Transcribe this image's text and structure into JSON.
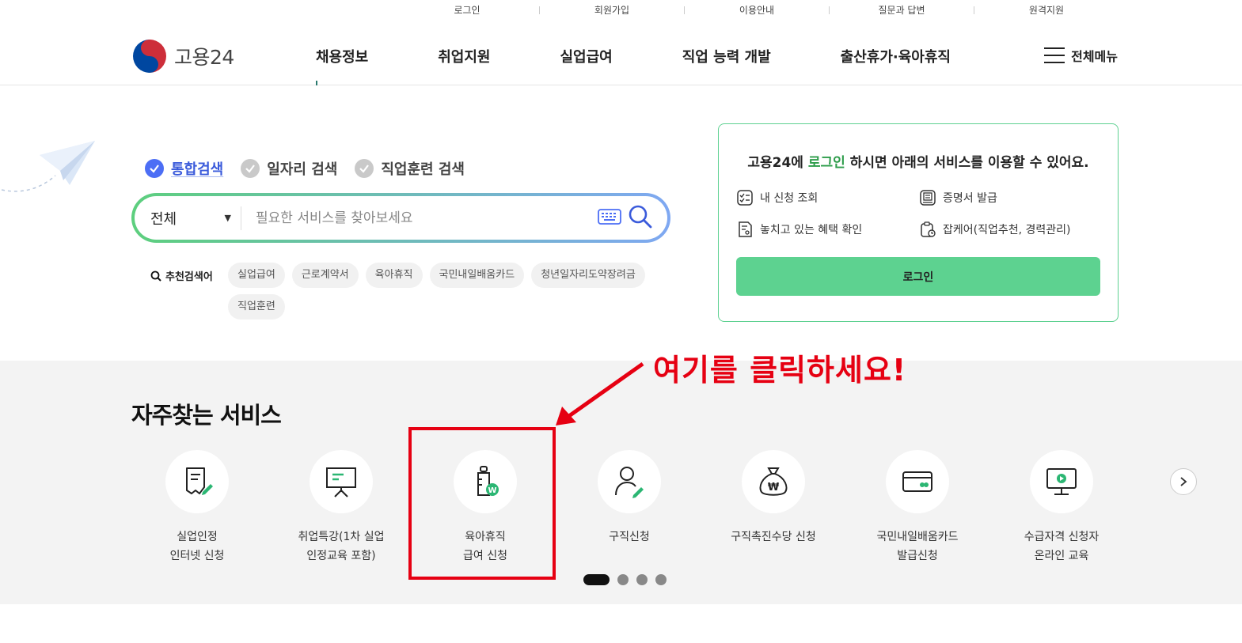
{
  "utility_links": [
    "로그인",
    "회원가입",
    "이용안내",
    "질문과 답변",
    "원격지원"
  ],
  "header": {
    "logo_text": "고용24",
    "nav": [
      "채용정보",
      "취업지원",
      "실업급여",
      "직업 능력 개발",
      "출산휴가·육아휴직"
    ],
    "all_menu": "전체메뉴"
  },
  "search": {
    "tabs": [
      {
        "label": "통합검색",
        "active": true
      },
      {
        "label": "일자리 검색",
        "active": false
      },
      {
        "label": "직업훈련 검색",
        "active": false
      }
    ],
    "category": "전체",
    "placeholder": "필요한 서비스를 찾아보세요",
    "recommend_label": "추천검색어",
    "keywords": [
      "실업급여",
      "근로계약서",
      "육아휴직",
      "국민내일배움카드",
      "청년일자리도약장려금",
      "직업훈련"
    ]
  },
  "login_box": {
    "title_pre": "고용24에 ",
    "title_hl": "로그인",
    "title_post": " 하시면 아래의 서비스를 이용할 수 있어요.",
    "services": [
      "내 신청 조회",
      "증명서 발급",
      "놓치고 있는 혜택 확인",
      "잡케어(직업추천, 경력관리)"
    ],
    "button": "로그인"
  },
  "frequent": {
    "title": "자주찾는 서비스",
    "items": [
      {
        "label": "실업인정\n인터넷 신청",
        "icon": "certificate-pen-icon"
      },
      {
        "label": "취업특강(1차 실업\n인정교육 포함)",
        "icon": "presentation-board-icon"
      },
      {
        "label": "육아휴직\n급여 신청",
        "icon": "baby-bottle-won-icon"
      },
      {
        "label": "구직신청",
        "icon": "person-pen-icon"
      },
      {
        "label": "구직촉진수당 신청",
        "icon": "money-bag-won-icon"
      },
      {
        "label": "국민내일배움카드\n발급신청",
        "icon": "card-icon"
      },
      {
        "label": "수급자격 신청자\n온라인 교육",
        "icon": "monitor-play-icon"
      }
    ]
  },
  "annotation": {
    "text": "여기를 클릭하세요!",
    "color": "#e60012"
  },
  "colors": {
    "brand_green": "#5dd290",
    "search_gradient_start": "#5dcf7e",
    "search_gradient_end": "#7fa8f2",
    "active_tab": "#4c6ef5"
  }
}
